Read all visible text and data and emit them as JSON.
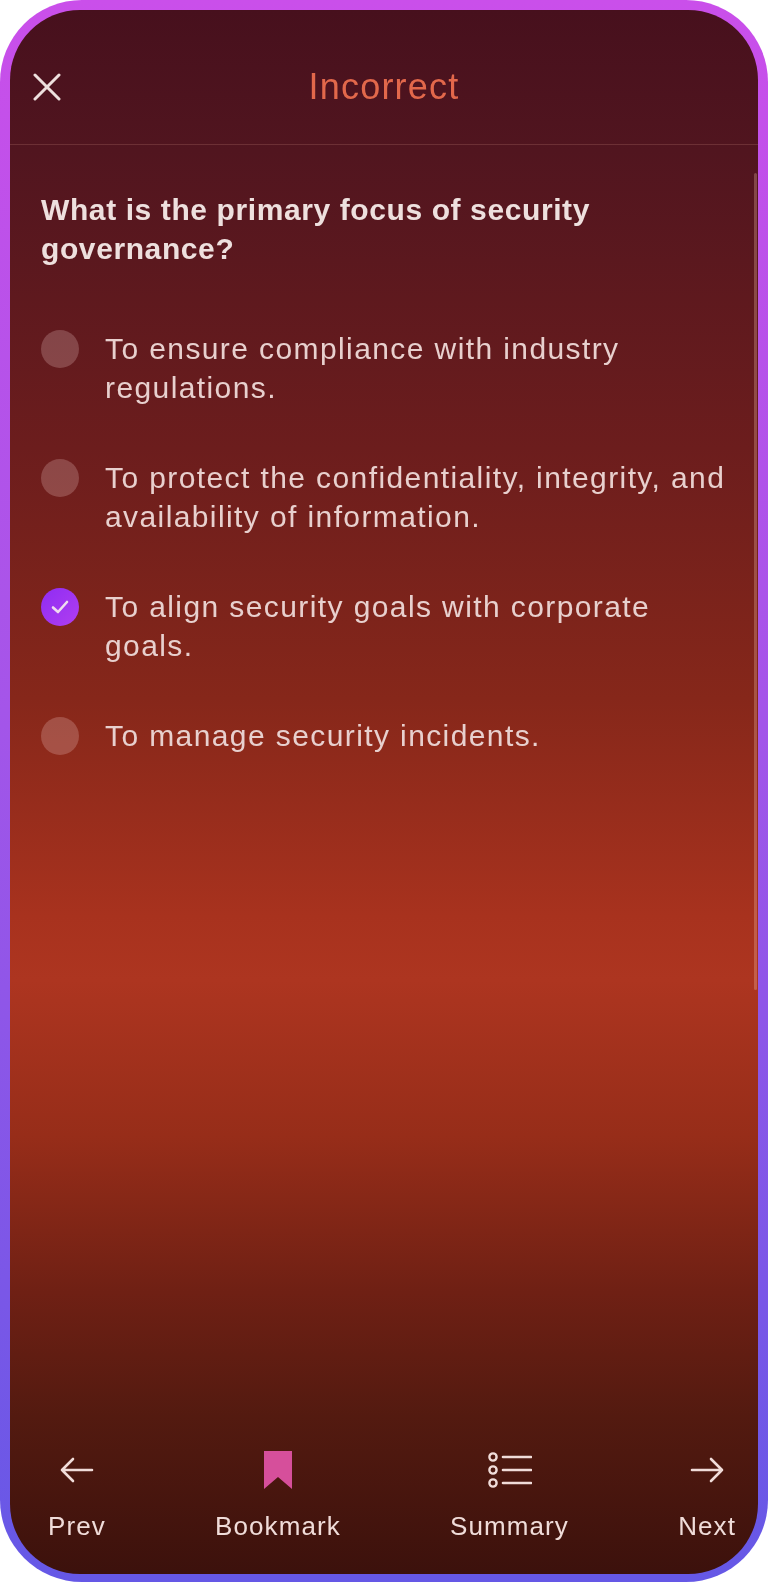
{
  "header": {
    "title": "Incorrect"
  },
  "question": {
    "text": "What is the primary focus of security governance?"
  },
  "options": [
    {
      "text": "To ensure compliance with industry regulations.",
      "selected": false
    },
    {
      "text": "To protect the confidentiality, integrity, and availability of information.",
      "selected": false
    },
    {
      "text": "To align security goals with corporate goals.",
      "selected": true
    },
    {
      "text": "To manage security incidents.",
      "selected": false
    }
  ],
  "bottom_nav": [
    {
      "kind": "prev",
      "label": "Prev",
      "active": false
    },
    {
      "kind": "bookmark",
      "label": "Bookmark",
      "active": true
    },
    {
      "kind": "summary",
      "label": "Summary",
      "active": false
    },
    {
      "kind": "next",
      "label": "Next",
      "active": false
    }
  ]
}
